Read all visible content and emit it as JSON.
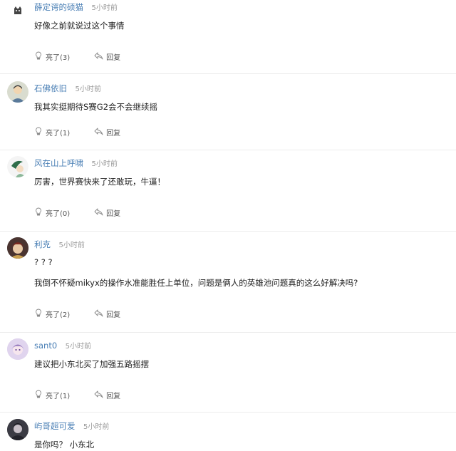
{
  "comments": [
    {
      "username": "薛定谔的硕猫",
      "time": "5小时前",
      "lines": [
        "好像之前就说过这个事情"
      ],
      "like_label": "亮了(3)",
      "reply_label": "回复"
    },
    {
      "username": "石佛依旧",
      "time": "5小时前",
      "lines": [
        "我其实挺期待S赛G2会不会继续摇"
      ],
      "like_label": "亮了(1)",
      "reply_label": "回复"
    },
    {
      "username": "风在山上呼啸",
      "time": "5小时前",
      "lines": [
        "厉害，世界赛快来了还敢玩，牛逼！"
      ],
      "like_label": "亮了(0)",
      "reply_label": "回复"
    },
    {
      "username": "利克",
      "time": "5小时前",
      "lines": [
        "? ? ?",
        "我倒不怀疑mikyx的操作水准能胜任上单位，问题是俩人的英雄池问题真的这么好解决吗?"
      ],
      "like_label": "亮了(2)",
      "reply_label": "回复"
    },
    {
      "username": "sant0",
      "time": "5小时前",
      "lines": [
        "建议把小东北买了加强五路摇摆"
      ],
      "like_label": "亮了(1)",
      "reply_label": "回复"
    },
    {
      "username": "屿哥超可爱",
      "time": "5小时前",
      "lines": [
        "是你吗？ 小东北"
      ],
      "like_label": "",
      "reply_label": ""
    }
  ],
  "icons": {
    "like": "lightbulb-icon",
    "reply": "reply-arrow-icon"
  },
  "colors": {
    "username": "#4a7fb5",
    "time": "#999999",
    "divider": "#ececec"
  }
}
